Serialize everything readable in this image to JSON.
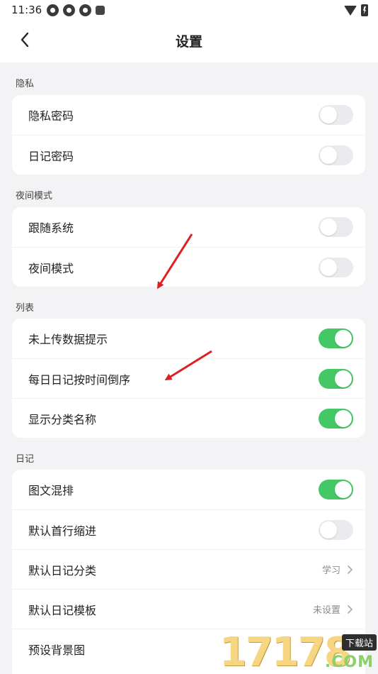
{
  "status_bar": {
    "time": "11:36",
    "icons": [
      "app-icon",
      "app-icon",
      "app-icon",
      "a-icon"
    ],
    "right_icons": [
      "wifi-icon",
      "battery-charging-icon"
    ]
  },
  "header": {
    "title": "设置",
    "back_icon": "chevron-left-icon"
  },
  "sections": {
    "privacy": {
      "label": "隐私",
      "rows": [
        {
          "label": "隐私密码",
          "toggle": false
        },
        {
          "label": "日记密码",
          "toggle": false
        }
      ]
    },
    "night": {
      "label": "夜间模式",
      "rows": [
        {
          "label": "跟随系统",
          "toggle": false
        },
        {
          "label": "夜间模式",
          "toggle": false
        }
      ]
    },
    "list": {
      "label": "列表",
      "rows": [
        {
          "label": "未上传数据提示",
          "toggle": true
        },
        {
          "label": "每日日记按时间倒序",
          "toggle": true
        },
        {
          "label": "显示分类名称",
          "toggle": true
        }
      ]
    },
    "diary": {
      "label": "日记",
      "rows": [
        {
          "label": "图文混排",
          "toggle": true
        },
        {
          "label": "默认首行缩进",
          "toggle": false
        },
        {
          "label": "默认日记分类",
          "value": "学习"
        },
        {
          "label": "默认日记模板",
          "value": "未设置"
        },
        {
          "label": "预设背景图",
          "value": ""
        }
      ]
    }
  },
  "colors": {
    "toggle_on": "#44c765",
    "toggle_off": "#ebebef",
    "background": "#f3f3f5",
    "annotation_arrow": "#e02020"
  },
  "watermark": {
    "digits": "17178",
    "badge": "下载站",
    "suffix": ".COM"
  }
}
